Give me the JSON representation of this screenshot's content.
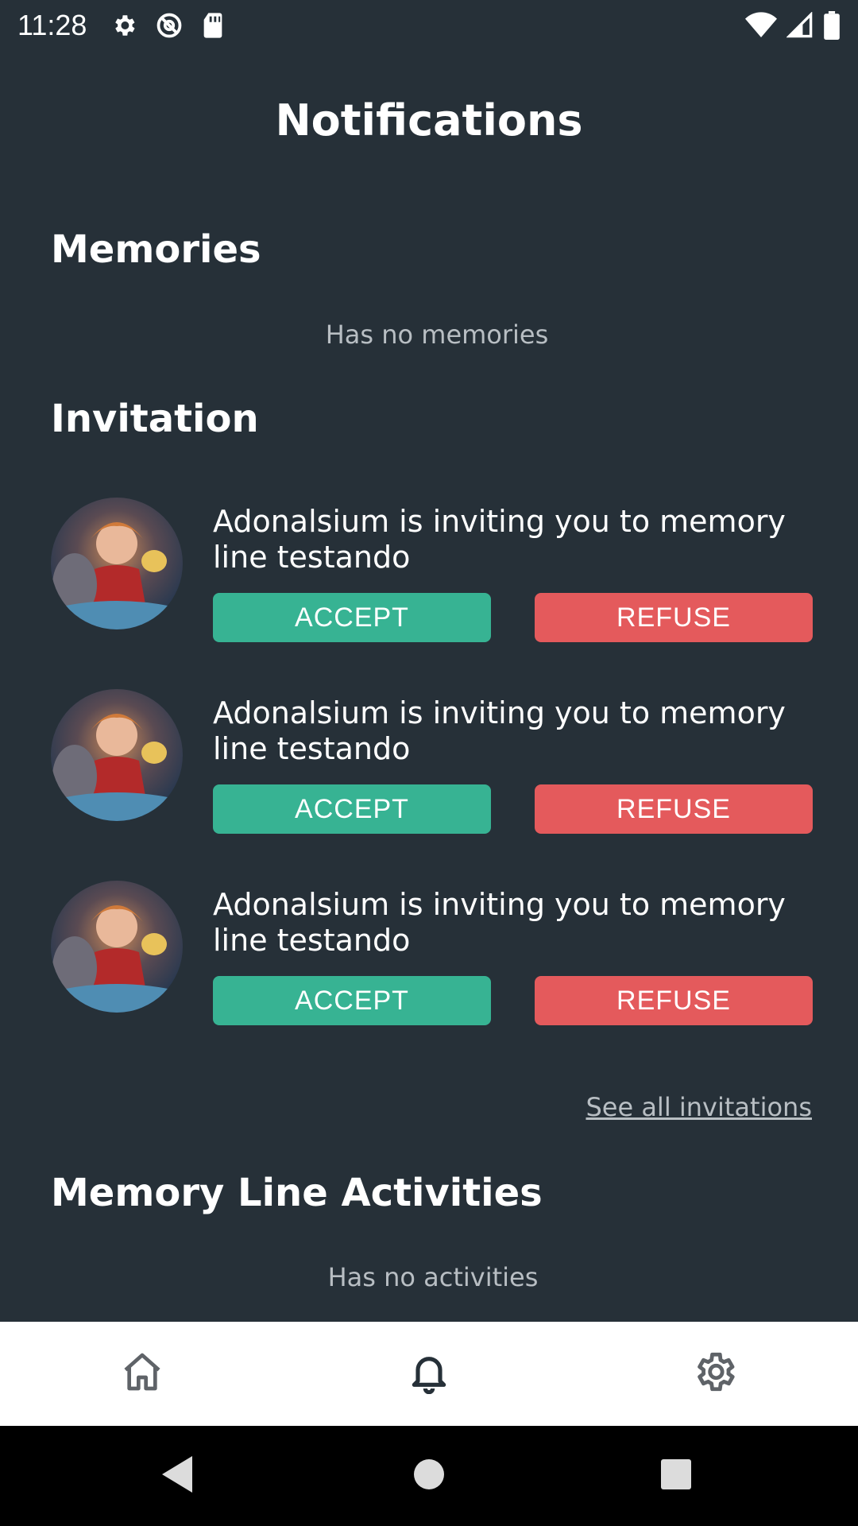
{
  "status_bar": {
    "time": "11:28",
    "left_icons": [
      "gear-icon",
      "at-sign-icon",
      "sd-card-icon"
    ],
    "right_icons": [
      "wifi-icon",
      "cell-signal-icon",
      "battery-icon"
    ]
  },
  "header": {
    "title": "Notifications"
  },
  "memories": {
    "title": "Memories",
    "empty_text": "Has no memories"
  },
  "invitations": {
    "title": "Invitation",
    "items": [
      {
        "text": "Adonalsium is inviting you to memory line testando",
        "accept_label": "ACCEPT",
        "refuse_label": "REFUSE"
      },
      {
        "text": "Adonalsium is inviting you to memory line testando",
        "accept_label": "ACCEPT",
        "refuse_label": "REFUSE"
      },
      {
        "text": "Adonalsium is inviting you to memory line testando",
        "accept_label": "ACCEPT",
        "refuse_label": "REFUSE"
      }
    ],
    "see_all_label": "See all invitations"
  },
  "activities": {
    "title": "Memory Line Activities",
    "empty_text": "Has no activities"
  },
  "bottom_nav": {
    "items": [
      "home-icon",
      "bell-icon",
      "settings-icon"
    ],
    "active": "bell-icon"
  },
  "system_nav": [
    "back-icon",
    "home-circle-icon",
    "recents-icon"
  ],
  "colors": {
    "background": "#263038",
    "accept": "#37b393",
    "refuse": "#e45a5c",
    "muted_text": "#b8bec3",
    "nav_bar": "#ffffff"
  }
}
